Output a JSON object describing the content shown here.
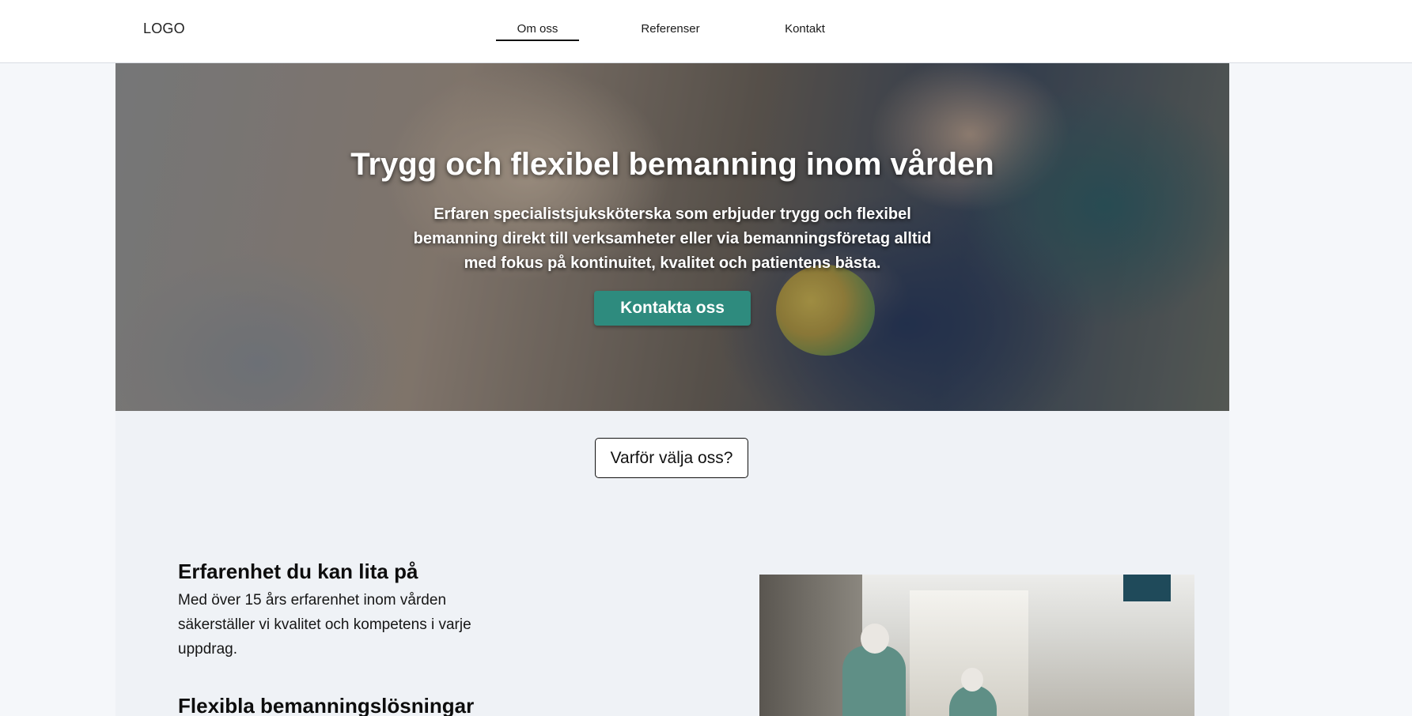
{
  "header": {
    "logo": "LOGO",
    "nav": [
      {
        "label": "Om oss",
        "active": true
      },
      {
        "label": "Referenser",
        "active": false
      },
      {
        "label": "Kontakt",
        "active": false
      }
    ]
  },
  "hero": {
    "title": "Trygg och flexibel bemanning inom vården",
    "subtitle": "Erfaren specialistsjuksköterska som erbjuder trygg och flexibel bemanning direkt till verksamheter eller via bemanningsföretag alltid med fokus på kontinuitet, kvalitet och patientens bästa.",
    "cta_label": "Kontakta oss",
    "cta_color": "#2e8b7e"
  },
  "why": {
    "label": "Varför välja oss?"
  },
  "features": [
    {
      "title": "Erfarenhet du kan lita på",
      "text": "Med över 15 års erfarenhet inom vården säkerställer vi kvalitet och kompetens i varje uppdrag."
    },
    {
      "title": "Flexibla bemanningslösningar"
    }
  ]
}
